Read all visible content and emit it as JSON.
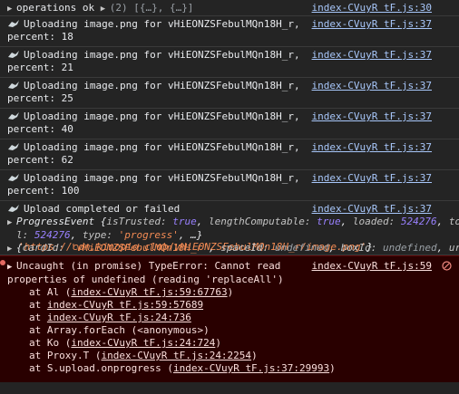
{
  "messages": [
    {
      "type": "log",
      "text": "operations ok ",
      "extra": "(2) [{…}, {…}]",
      "source": "index-CVuyR tF.js:30"
    },
    {
      "type": "upload",
      "line1": "Uploading image.png for vHiEONZSFebulMQn18H_r,",
      "line2": "percent: 18",
      "source": "index-CVuyR tF.js:37"
    },
    {
      "type": "upload",
      "line1": "Uploading image.png for vHiEONZSFebulMQn18H_r,",
      "line2": "percent: 21",
      "source": "index-CVuyR tF.js:37"
    },
    {
      "type": "upload",
      "line1": "Uploading image.png for vHiEONZSFebulMQn18H_r,",
      "line2": "percent: 25",
      "source": "index-CVuyR tF.js:37"
    },
    {
      "type": "upload",
      "line1": "Uploading image.png for vHiEONZSFebulMQn18H_r,",
      "line2": "percent: 40",
      "source": "index-CVuyR tF.js:37"
    },
    {
      "type": "upload",
      "line1": "Uploading image.png for vHiEONZSFebulMQn18H_r,",
      "line2": "percent: 62",
      "source": "index-CVuyR tF.js:37"
    },
    {
      "type": "upload",
      "line1": "Uploading image.png for vHiEONZSFebulMQn18H_r,",
      "line2": "percent: 100",
      "source": "index-CVuyR tF.js:37"
    }
  ],
  "completed": {
    "text": "Upload completed or failed",
    "source": "index-CVuyR tF.js:37",
    "progress_event": {
      "name": "ProgressEvent",
      "isTrusted_key": "isTrusted:",
      "isTrusted_val": "true",
      "lengthComputable_key": "lengthComputable:",
      "lengthComputable_val": "true",
      "loaded_key": "loaded:",
      "loaded_val": "524276",
      "tota_key": "tota",
      "l_key": "l:",
      "total_val": "524276",
      "type_key": "type:",
      "type_val": "'progress'",
      "tail": ", …}"
    },
    "detail": {
      "cardId_key": "cardId:",
      "cardId_val": "'vHiEONZSFebulMQn18H_r'",
      "spaceId_key": "spaceId:",
      "spaceId_val": "undefined",
      "boxId_key": "boxId:",
      "boxId_val": "undefined",
      "url_key": "url:",
      "url_val": "'https://cdn.kinopio.club/vHiEONZSFebulMQn18H_r/image.png'"
    }
  },
  "error": {
    "line1": "Uncaught (in promise) TypeError: Cannot read",
    "line2": "properties of undefined (reading 'replaceAll')",
    "source": "index-CVuyR tF.js:59",
    "at": "at",
    "stack": [
      {
        "fn": "Al",
        "link": "index-CVuyR tF.js:59:67763",
        "paren": true
      },
      {
        "fn": "",
        "link": "index-CVuyR tF.js:59:57689",
        "paren": false
      },
      {
        "fn": "",
        "link": "index-CVuyR tF.js:24:736",
        "paren": false
      },
      {
        "fn": "Array.forEach",
        "plain": "(<anonymous>)"
      },
      {
        "fn": "Ko",
        "link": "index-CVuyR tF.js:24:724",
        "paren": true
      },
      {
        "fn": "Proxy.T",
        "link": "index-CVuyR tF.js:24:2254",
        "paren": true
      },
      {
        "fn": "S.upload.onprogress",
        "link": "index-CVuyR tF.js:37:29993",
        "paren": true
      }
    ]
  }
}
